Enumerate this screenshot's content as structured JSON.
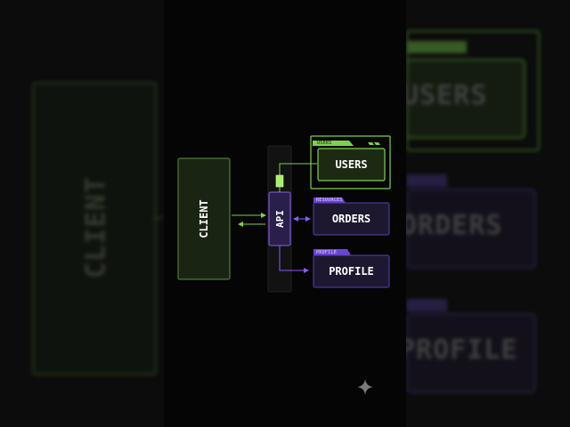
{
  "colors": {
    "green": "#7fd14b",
    "green_dark": "#1c2a14",
    "purple": "#8a5cf0",
    "purple_dark": "#1d1830",
    "background": "#050505"
  },
  "background_labels": {
    "client": "CLIENT",
    "users": "USERS",
    "orders": "ORDERS",
    "profile": "PROFILE"
  },
  "diagram": {
    "client": {
      "label": "CLIENT"
    },
    "api": {
      "label": "API"
    },
    "users": {
      "label": "USERS",
      "tag": "USERS"
    },
    "orders": {
      "label": "ORDERS",
      "tag": "RESOURCES"
    },
    "profile": {
      "label": "PROFILE",
      "tag": "PROFILE"
    }
  },
  "icons": {
    "corner": "sparkle-icon"
  }
}
